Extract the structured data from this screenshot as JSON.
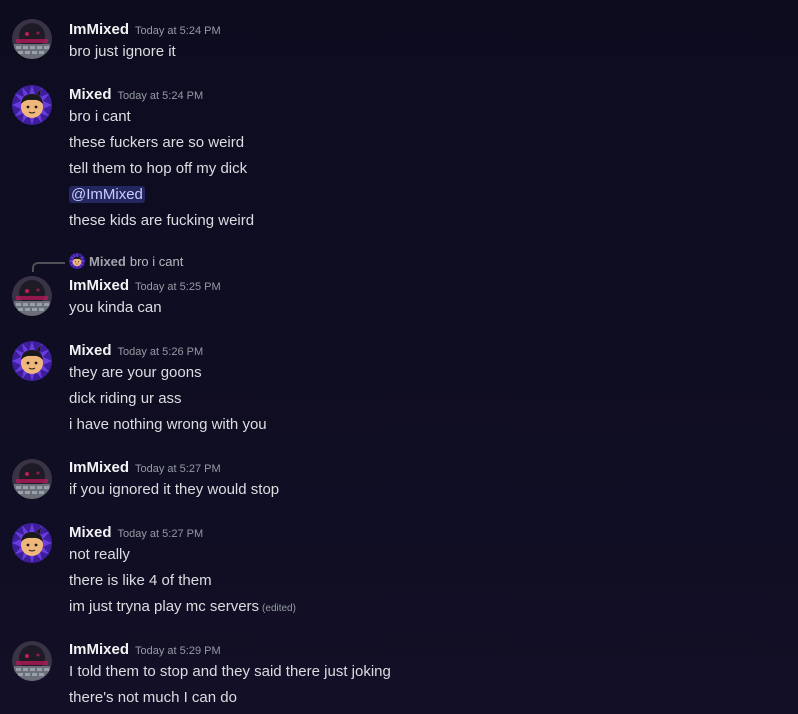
{
  "messages": [
    {
      "author": "ImMixed",
      "timestamp": "Today at 5:24 PM",
      "avatar": "immixed-avatar",
      "lines": [
        "bro just ignore it"
      ]
    },
    {
      "author": "Mixed",
      "timestamp": "Today at 5:24 PM",
      "avatar": "mixed-avatar",
      "lines": [
        "bro i cant",
        "these fuckers are so weird",
        "tell them to hop off my dick",
        "@ImMixed",
        "these kids are fucking weird"
      ]
    },
    {
      "reply_to": {
        "author": "Mixed",
        "text": "bro i cant"
      },
      "author": "ImMixed",
      "timestamp": "Today at 5:25 PM",
      "avatar": "immixed-avatar",
      "lines": [
        "you kinda can"
      ]
    },
    {
      "author": "Mixed",
      "timestamp": "Today at 5:26 PM",
      "avatar": "mixed-avatar",
      "lines": [
        "they are your goons",
        "dick riding ur ass",
        "i have nothing wrong with you"
      ]
    },
    {
      "author": "ImMixed",
      "timestamp": "Today at 5:27 PM",
      "avatar": "immixed-avatar",
      "lines": [
        "if you ignored it they would stop"
      ]
    },
    {
      "author": "Mixed",
      "timestamp": "Today at 5:27 PM",
      "avatar": "mixed-avatar",
      "lines": [
        "not really",
        "there is like 4 of them",
        "im just tryna play mc servers"
      ],
      "edited_label": "(edited)"
    },
    {
      "author": "ImMixed",
      "timestamp": "Today at 5:29 PM",
      "avatar": "immixed-avatar",
      "lines": [
        "I told them to stop and they said there just joking",
        "there's not much I can do"
      ]
    }
  ],
  "colors": {
    "background": "#0e0c21",
    "mention_bg": "#3b3f8a",
    "text": "#dbdee1",
    "username": "#f2f3f5",
    "timestamp": "#949ba4"
  }
}
